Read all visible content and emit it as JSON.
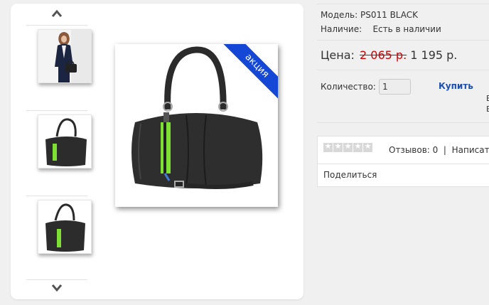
{
  "product": {
    "model_label": "Модель:",
    "model_value": "PS011 BLACK",
    "availability_label": "Наличие:",
    "availability_value": "Есть в наличии",
    "price_label": "Цена:",
    "old_price": "2 065 р.",
    "new_price": "1 195 р.",
    "quantity_label": "Количество:",
    "quantity_value": "1",
    "buy_label": "Купить",
    "cut_text_1": "Е",
    "cut_text_2": "Е"
  },
  "reviews": {
    "count_text": "Отзывов: 0",
    "separator": "|",
    "write_text": "Написат"
  },
  "share": {
    "label": "Поделиться"
  },
  "gallery": {
    "badge": "акция",
    "icons": [
      "chevron-up-icon",
      "chevron-down-icon"
    ]
  },
  "colors": {
    "accent": "#1447d6",
    "old_price": "#d00000",
    "link": "#1d4fb0"
  }
}
